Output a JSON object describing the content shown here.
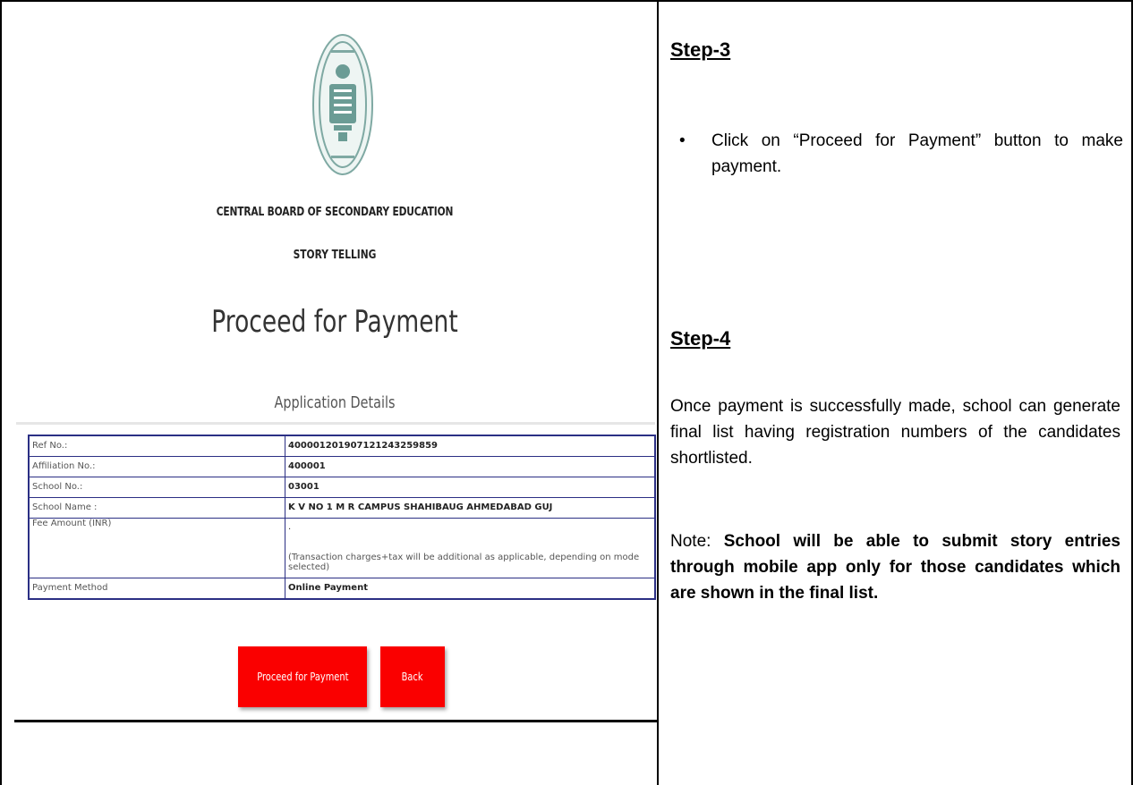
{
  "left_panel": {
    "emblem_icon": "cbse-emblem",
    "org_name": "CENTRAL BOARD OF SECONDARY EDUCATION",
    "event_name": "STORY TELLING",
    "page_heading": "Proceed for Payment",
    "sub_heading": "Application Details",
    "details": [
      {
        "label": "Ref No.:",
        "value": "400001201907121243259859"
      },
      {
        "label": "Affiliation No.:",
        "value": "400001"
      },
      {
        "label": "School No.:",
        "value": "03001"
      },
      {
        "label": "School Name :",
        "value": "K V NO 1 M R CAMPUS SHAHIBAUG AHMEDABAD GUJ"
      },
      {
        "label": "Fee Amount (INR)",
        "value": ".",
        "note": "(Transaction charges+tax will be additional as applicable, depending on mode selected)"
      },
      {
        "label": "Payment Method",
        "value": "Online Payment"
      }
    ],
    "buttons": {
      "proceed": "Proceed for Payment",
      "back": "Back"
    },
    "button_color": "#fa0000",
    "table_border_color": "#2b2f84"
  },
  "right_panel": {
    "step3_title": "Step-3",
    "step3_bullet": "Click on “Proceed for Payment” button to make payment.",
    "step4_title": "Step-4",
    "step4_text": "Once payment is successfully made, school  can generate final list having registration numbers of the candidates shortlisted.",
    "note_prefix": "Note: ",
    "note_bold": "School will be able to submit story entries through mobile app only for those candidates which are shown in the final list."
  }
}
